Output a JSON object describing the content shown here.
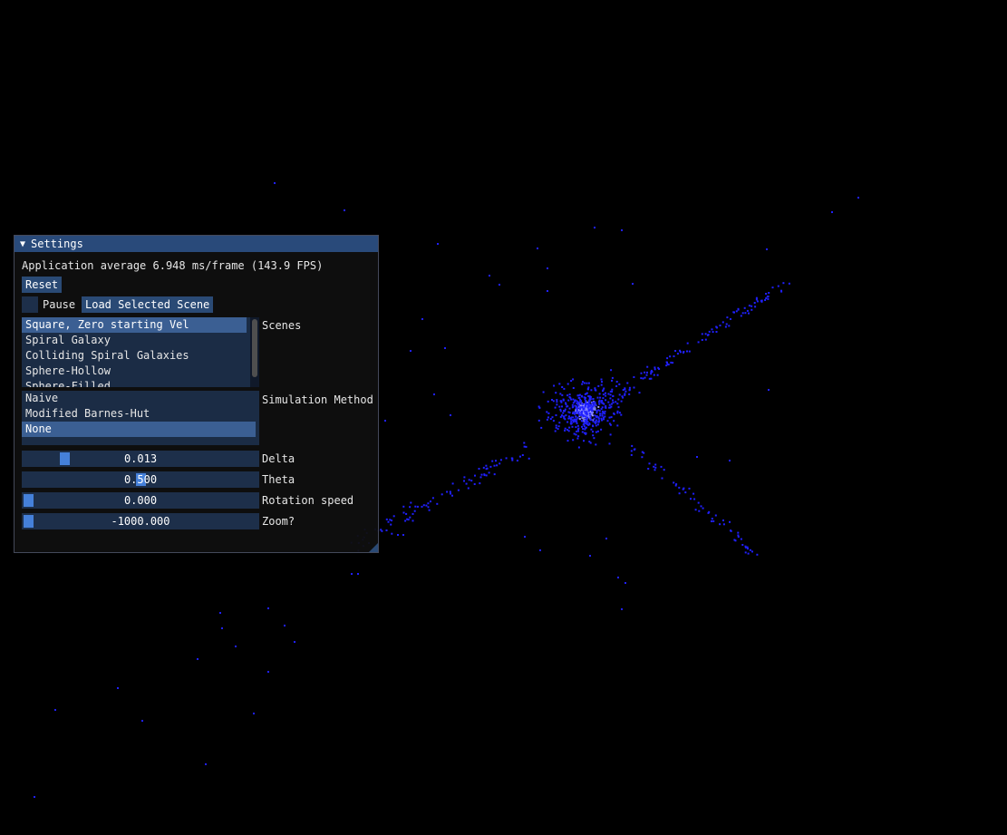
{
  "window": {
    "title": "Settings",
    "collapse_icon": "triangle-down-icon"
  },
  "stats": {
    "fps_text": "Application average 6.948 ms/frame (143.9 FPS)"
  },
  "buttons": {
    "reset": "Reset",
    "load_scene": "Load Selected Scene"
  },
  "pause": {
    "label": "Pause",
    "checked": false
  },
  "scenes": {
    "label": "Scenes",
    "items": [
      "Square, Zero starting Vel",
      "Spiral Galaxy",
      "Colliding Spiral Galaxies",
      "Sphere-Hollow",
      "Sphere-Filled"
    ],
    "selected_index": 0
  },
  "simulation_method": {
    "label": "Simulation Method",
    "items": [
      "Naive",
      "Modified Barnes-Hut",
      "None"
    ],
    "selected_index": 2
  },
  "sliders": {
    "delta": {
      "label": "Delta",
      "value_text": "0.013",
      "fraction": 0.16
    },
    "theta": {
      "label": "Theta",
      "value_text": "0.500",
      "fraction": 0.5
    },
    "rotation": {
      "label": "Rotation speed",
      "value_text": "0.000",
      "fraction": 0.0
    },
    "zoom": {
      "label": "Zoom?",
      "value_text": "-1000.000",
      "fraction": 0.0
    }
  },
  "colors": {
    "background": "#000000",
    "particle": "#2020ff",
    "particle_core": "#a0a0ff",
    "title_bar": "#294a7a",
    "accent": "#4580d9"
  }
}
